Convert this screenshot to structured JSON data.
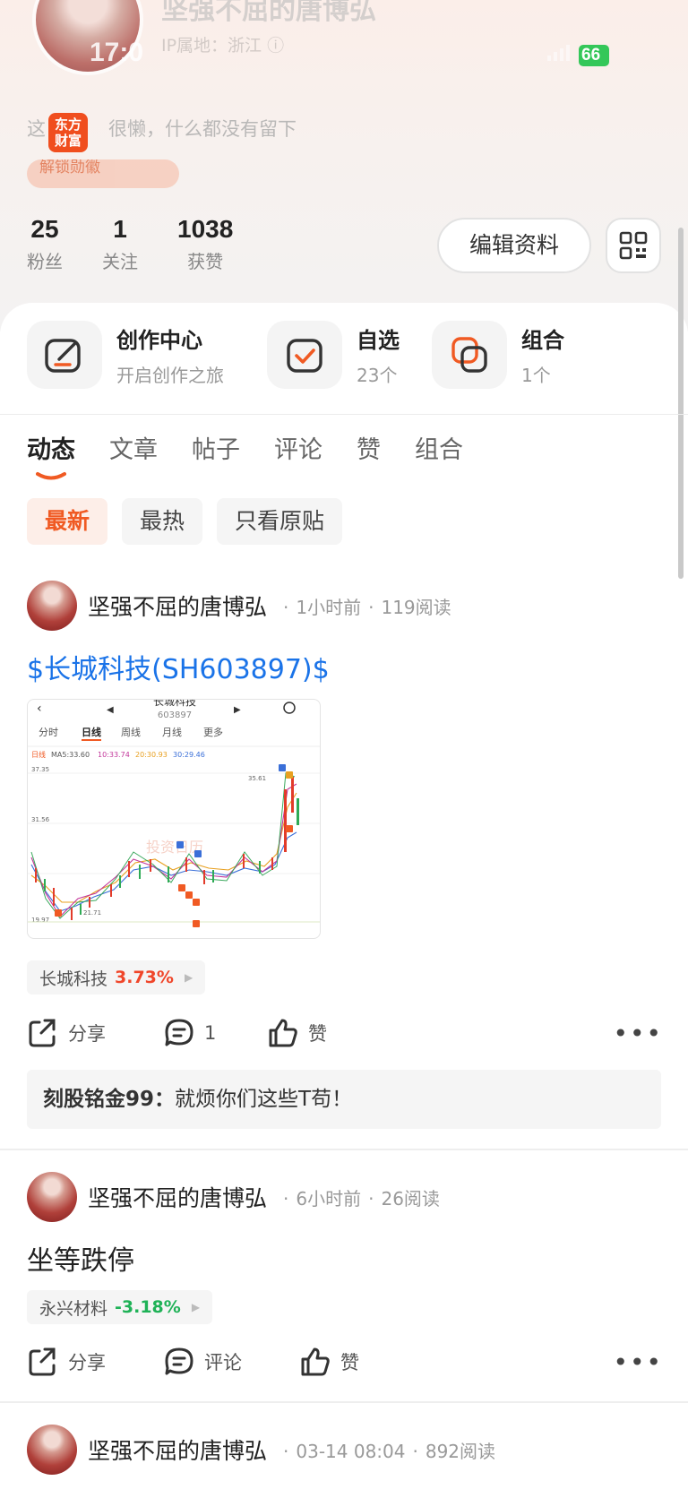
{
  "status_bar": {
    "time": "17:0",
    "battery": "66"
  },
  "profile": {
    "name": "坚强不屈的唐博弘",
    "ip_location": "IP属地：浙江",
    "app_badge": "东方财富",
    "bio_start": "这",
    "bio_end": "很懒，什么都没有留下",
    "medal_label": "解锁勋徽",
    "stats": [
      {
        "value": "25",
        "label": "粉丝"
      },
      {
        "value": "1",
        "label": "关注"
      },
      {
        "value": "1038",
        "label": "获赞"
      }
    ],
    "edit_label": "编辑资料"
  },
  "quick_links": [
    {
      "title": "创作中心",
      "sub": "开启创作之旅",
      "icon": "edit-icon"
    },
    {
      "title": "自选",
      "sub": "23个",
      "icon": "checkbox-icon"
    },
    {
      "title": "组合",
      "sub": "1个",
      "icon": "portfolio-icon"
    }
  ],
  "tabs": [
    "动态",
    "文章",
    "帖子",
    "评论",
    "赞",
    "组合"
  ],
  "filters": [
    "最新",
    "最热",
    "只看原贴"
  ],
  "accent_color": "#f05a23",
  "posts": [
    {
      "author": "坚强不屈的唐博弘",
      "time": "1小时前",
      "reads": "119阅读",
      "title": "$长城科技(SH603897)$",
      "stock_name": "长城科技",
      "stock_change": "3.73%",
      "share_label": "分享",
      "comment_count": "1",
      "like_label": "赞",
      "comment_user": "刻股铭金99：",
      "comment_text": "就烦你们这些T苟！",
      "chart": {
        "title": "长城科技",
        "code": "603897",
        "tabs": [
          "分时",
          "日线",
          "周线",
          "月线",
          "更多"
        ],
        "ma_legend": [
          "日线",
          "MA5:33.60",
          "10:33.74",
          "20:30.93",
          "30:29.46"
        ],
        "y_ticks": [
          "37.35",
          "31.56",
          "19.97"
        ],
        "high_label": "35.61",
        "low_label": "21.71",
        "watermark": "投资日历"
      }
    },
    {
      "author": "坚强不屈的唐博弘",
      "time": "6小时前",
      "reads": "26阅读",
      "title": "坐等跌停",
      "stock_name": "永兴材料",
      "stock_change": "-3.18%",
      "share_label": "分享",
      "comment_label": "评论",
      "like_label": "赞"
    },
    {
      "author": "坚强不屈的唐博弘",
      "time": "03-14 08:04",
      "reads": "892阅读"
    }
  ]
}
